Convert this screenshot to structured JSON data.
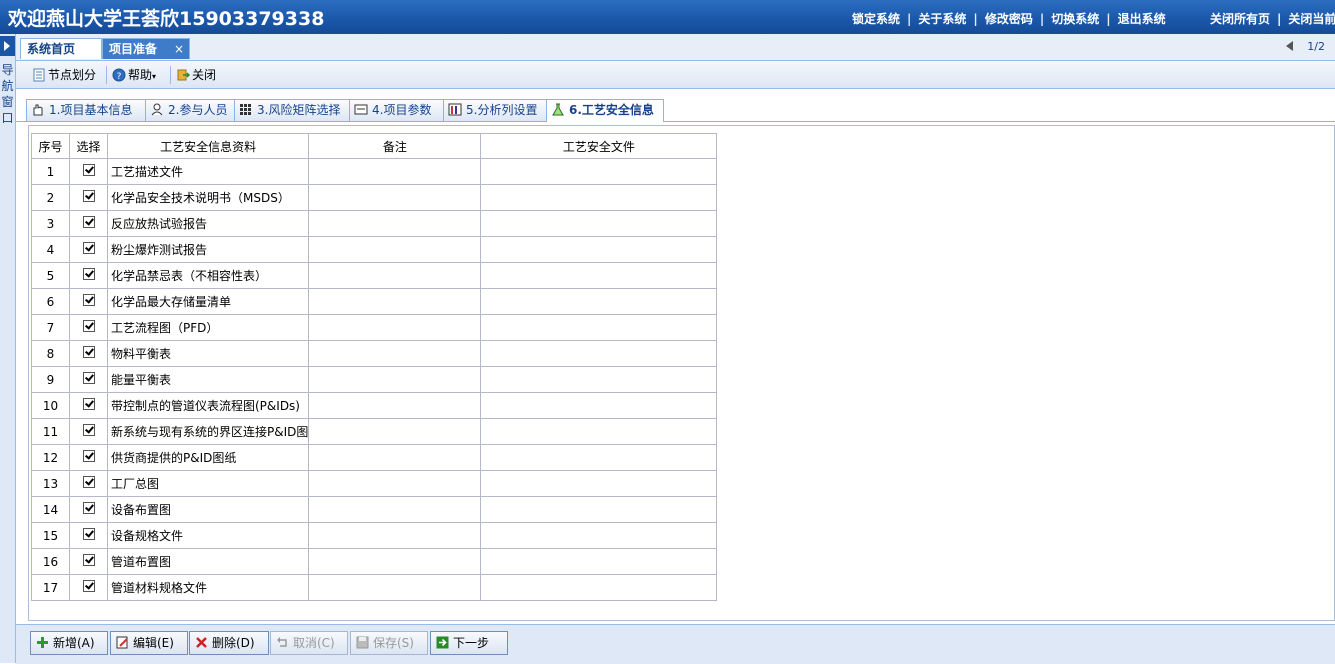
{
  "header": {
    "title": "欢迎燕山大学王荟欣15903379338",
    "links": [
      "锁定系统",
      "关于系统",
      "修改密码",
      "切换系统",
      "退出系统"
    ],
    "right_links": [
      "关闭所有页",
      "关闭当前"
    ]
  },
  "leftnav": {
    "label": "导航窗口"
  },
  "page_tabs": {
    "home": "系统首页",
    "project": "项目准备",
    "close": "×",
    "pager": "1/2"
  },
  "toolbar": {
    "nodes": "节点划分",
    "help": "帮助",
    "close": "关闭"
  },
  "section_tabs": [
    "1.项目基本信息",
    "2.参与人员",
    "3.风险矩阵选择",
    "4.项目参数",
    "5.分析列设置",
    "6.工艺安全信息"
  ],
  "grid": {
    "columns": [
      "序号",
      "选择",
      "工艺安全信息资料",
      "备注",
      "工艺安全文件"
    ],
    "rows": [
      {
        "no": "1",
        "checked": true,
        "name": "工艺描述文件"
      },
      {
        "no": "2",
        "checked": true,
        "name": "化学品安全技术说明书（MSDS）"
      },
      {
        "no": "3",
        "checked": true,
        "name": "反应放热试验报告"
      },
      {
        "no": "4",
        "checked": true,
        "name": "粉尘爆炸测试报告"
      },
      {
        "no": "5",
        "checked": true,
        "name": "化学品禁忌表（不相容性表）"
      },
      {
        "no": "6",
        "checked": true,
        "name": "化学品最大存储量清单"
      },
      {
        "no": "7",
        "checked": true,
        "name": "工艺流程图（PFD）"
      },
      {
        "no": "8",
        "checked": true,
        "name": "物料平衡表"
      },
      {
        "no": "9",
        "checked": true,
        "name": "能量平衡表"
      },
      {
        "no": "10",
        "checked": true,
        "name": "带控制点的管道仪表流程图(P&IDs)"
      },
      {
        "no": "11",
        "checked": true,
        "name": "新系统与现有系统的界区连接P&ID图"
      },
      {
        "no": "12",
        "checked": true,
        "name": "供货商提供的P&ID图纸"
      },
      {
        "no": "13",
        "checked": true,
        "name": "工厂总图"
      },
      {
        "no": "14",
        "checked": true,
        "name": "设备布置图"
      },
      {
        "no": "15",
        "checked": true,
        "name": "设备规格文件"
      },
      {
        "no": "16",
        "checked": true,
        "name": "管道布置图"
      },
      {
        "no": "17",
        "checked": true,
        "name": "管道材料规格文件"
      }
    ]
  },
  "buttons": {
    "add": "新增(A)",
    "edit": "编辑(E)",
    "delete": "删除(D)",
    "cancel": "取消(C)",
    "save": "保存(S)",
    "next": "下一步"
  }
}
